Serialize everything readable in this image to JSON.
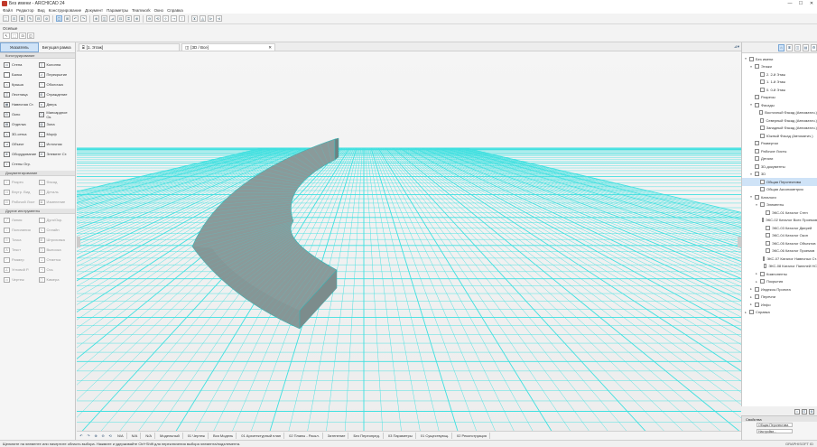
{
  "window": {
    "title": "Без имени - ARCHICAD 24",
    "controls": [
      "—",
      "☐",
      "✕"
    ]
  },
  "menu": [
    "Файл",
    "Редактор",
    "Вид",
    "Конструирование",
    "Документ",
    "Параметры",
    "Teamwork",
    "Окно",
    "Справка"
  ],
  "subbar": {
    "label": "Осевые",
    "modes": [
      "↖",
      "⬚",
      "⊡",
      "◫"
    ]
  },
  "toolbox": {
    "tabs": [
      "Указатель",
      "Бегущая рамка"
    ],
    "sections": [
      {
        "title": "Конструирование",
        "dim": false,
        "tools": [
          [
            "▭",
            "Стена"
          ],
          [
            "▯",
            "Колонна"
          ],
          [
            "⌒",
            "Балка"
          ],
          [
            "▱",
            "Перекрытие"
          ],
          [
            "⌂",
            "Крыша"
          ],
          [
            "◠",
            "Оболочка"
          ],
          [
            "▒",
            "Лестница"
          ],
          [
            "⊞",
            "Ограждение"
          ],
          [
            "▦",
            "Навесная Ст."
          ],
          [
            "⊏",
            "Дверь"
          ],
          [
            "⊟",
            "Окно"
          ],
          [
            "◳",
            "Мансардное Ок."
          ],
          [
            "▤",
            "Отделка"
          ],
          [
            "▥",
            "Зона"
          ],
          [
            "◬",
            "3D-сетка"
          ],
          [
            "◇",
            "Морф"
          ],
          [
            "⊿",
            "Объект"
          ],
          [
            "◎",
            "Источник"
          ],
          [
            "⊕",
            "Оборудование"
          ],
          [
            "⊖",
            "Элемент Ст."
          ],
          [
            "⌗",
            "Стены Огр."
          ]
        ]
      },
      {
        "title": "Документирование",
        "dim": true,
        "tools": [
          [
            "⊹",
            "Разрез"
          ],
          [
            "⊸",
            "Фасад"
          ],
          [
            "⊶",
            "Внутр. Вид"
          ],
          [
            "⊷",
            "Деталь"
          ],
          [
            "⊡",
            "Рабочий Лист"
          ],
          [
            "⊠",
            "Изменение"
          ]
        ]
      },
      {
        "title": "Другие инструменты",
        "dim": true,
        "tools": [
          [
            "╱",
            "Линия"
          ],
          [
            "◠",
            "Дуга/Окр."
          ],
          [
            "≈",
            "Полилиния"
          ],
          [
            "∿",
            "Сплайн"
          ],
          [
            "⊙",
            "Точка"
          ],
          [
            "⊞",
            "Штриховка"
          ],
          [
            "A",
            "Текст"
          ],
          [
            "◳",
            "Выноска"
          ],
          [
            "⌐",
            "Размер"
          ],
          [
            "⊥",
            "Отметка"
          ],
          [
            "∠",
            "Угловой Р."
          ],
          [
            "⊣",
            "Ось"
          ],
          [
            "▭",
            "Чертеж"
          ],
          [
            "◫",
            "Камера"
          ]
        ]
      }
    ]
  },
  "tabs": [
    {
      "label": "[1. Этаж]",
      "active": false,
      "close": ""
    },
    {
      "label": "[3D / Все]",
      "active": true,
      "close": "✕"
    }
  ],
  "tabs_right": "⊿▾",
  "navigator": {
    "head_buttons": [
      "⌂",
      "⌸",
      "◫",
      "▤",
      "⚙"
    ],
    "items": [
      {
        "depth": 0,
        "twisty": "▾",
        "label": "Без имени",
        "sel": false
      },
      {
        "depth": 1,
        "twisty": "▾",
        "label": "Этажи",
        "sel": false
      },
      {
        "depth": 2,
        "twisty": "",
        "label": "2. 2-й Этаж",
        "sel": false
      },
      {
        "depth": 2,
        "twisty": "",
        "label": "1. 1-й Этаж",
        "sel": false
      },
      {
        "depth": 2,
        "twisty": "",
        "label": "0. 0-й Этаж",
        "sel": false
      },
      {
        "depth": 1,
        "twisty": "",
        "label": "Разрезы",
        "sel": false
      },
      {
        "depth": 1,
        "twisty": "▾",
        "label": "Фасады",
        "sel": false
      },
      {
        "depth": 2,
        "twisty": "",
        "label": "Восточный Фасад (Автоматич.)",
        "sel": false
      },
      {
        "depth": 2,
        "twisty": "",
        "label": "Северный Фасад (Автоматич.)",
        "sel": false
      },
      {
        "depth": 2,
        "twisty": "",
        "label": "Западный Фасад (Автоматич.)",
        "sel": false
      },
      {
        "depth": 2,
        "twisty": "",
        "label": "Южный Фасад (Автоматич.)",
        "sel": false
      },
      {
        "depth": 1,
        "twisty": "",
        "label": "Развертки",
        "sel": false
      },
      {
        "depth": 1,
        "twisty": "",
        "label": "Рабочие Листы",
        "sel": false
      },
      {
        "depth": 1,
        "twisty": "",
        "label": "Детали",
        "sel": false
      },
      {
        "depth": 1,
        "twisty": "",
        "label": "3D-документы",
        "sel": false
      },
      {
        "depth": 1,
        "twisty": "▾",
        "label": "3D",
        "sel": false
      },
      {
        "depth": 2,
        "twisty": "",
        "label": "Общая Перспектива",
        "sel": true
      },
      {
        "depth": 2,
        "twisty": "",
        "label": "Общая Аксонометрия",
        "sel": false
      },
      {
        "depth": 1,
        "twisty": "▾",
        "label": "Каталоги",
        "sel": false
      },
      {
        "depth": 2,
        "twisty": "▾",
        "label": "Элементы",
        "sel": false
      },
      {
        "depth": 3,
        "twisty": "",
        "label": "ЭКС-01 Каталог Стен",
        "sel": false
      },
      {
        "depth": 3,
        "twisty": "",
        "label": "ЭКС-02 Каталог Всех Проемов",
        "sel": false
      },
      {
        "depth": 3,
        "twisty": "",
        "label": "ЭКС-03 Каталог Дверей",
        "sel": false
      },
      {
        "depth": 3,
        "twisty": "",
        "label": "ЭКС-04 Каталог Окон",
        "sel": false
      },
      {
        "depth": 3,
        "twisty": "",
        "label": "ЭКС-05 Каталог Объектов",
        "sel": false
      },
      {
        "depth": 3,
        "twisty": "",
        "label": "ЭКС-06 Каталог Проемов",
        "sel": false
      },
      {
        "depth": 3,
        "twisty": "",
        "label": "ЭКС-07 Каталог Навесных Ст.",
        "sel": false
      },
      {
        "depth": 3,
        "twisty": "",
        "label": "ЭКС-08 Каталог Панелей НС",
        "sel": false
      },
      {
        "depth": 2,
        "twisty": "▸",
        "label": "Компоненты",
        "sel": false
      },
      {
        "depth": 2,
        "twisty": "▸",
        "label": "Покрытия",
        "sel": false
      },
      {
        "depth": 1,
        "twisty": "▸",
        "label": "Индексы Проекта",
        "sel": false
      },
      {
        "depth": 1,
        "twisty": "▸",
        "label": "Перечни",
        "sel": false
      },
      {
        "depth": 1,
        "twisty": "▸",
        "label": "Инфо",
        "sel": false
      },
      {
        "depth": 0,
        "twisty": "▸",
        "label": "Справка",
        "sel": false
      }
    ],
    "footer": [
      "⌂",
      "⊡",
      "⚙"
    ]
  },
  "properties": {
    "header": "Свойства",
    "rows": [
      {
        "label": "",
        "value": "Общая Перспектива"
      },
      {
        "label": "",
        "value": "Настройки..."
      }
    ]
  },
  "vp_status": {
    "icons": [
      "↶",
      "↷",
      "⊕",
      "⊖",
      "⟲"
    ],
    "segments": [
      "N/A",
      "N/A",
      "N/A",
      "Модельный",
      "01 Чертеж",
      "Вся Модель",
      "01 Архитектурный план",
      "02 Планы - Раскл.",
      "Затенение",
      "Без Переопред.",
      "03 Параметры",
      "01 Существующ.",
      "02 Реконструкция"
    ]
  },
  "statusbar": {
    "hint": "Щелкните на элементе или начертите область выбора. Нажмите и удерживайте Ctrl+Shift для переключения выбора элемента/подэлемента.",
    "right": "GRAPHISOFT ID"
  },
  "colors": {
    "grid": "#3fe0e0",
    "shape_fill": "#8a9a9a",
    "shape_line": "#4dcfcf",
    "select": "#cfe3f7"
  }
}
